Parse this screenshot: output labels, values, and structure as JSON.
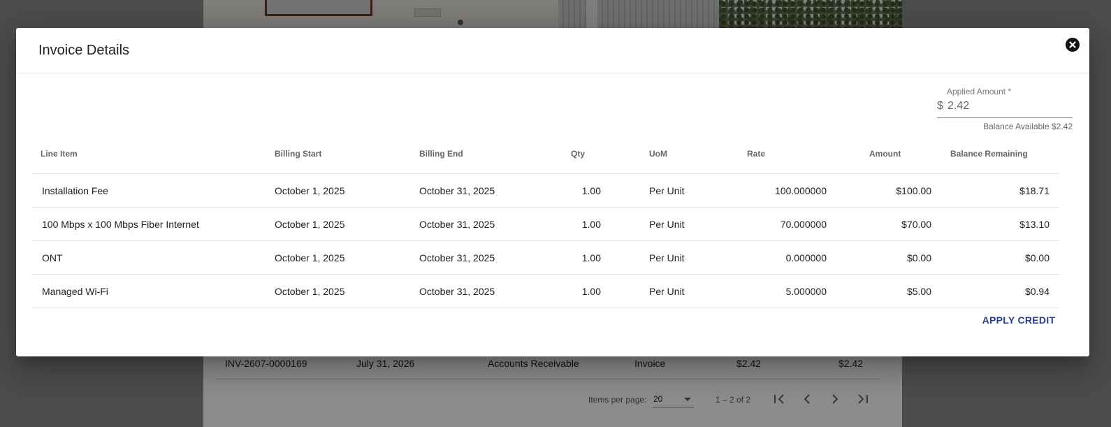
{
  "background": {
    "row": {
      "invoice": "INV-2607-0000169",
      "date": "July 31, 2026",
      "account": "Accounts Receivable",
      "type": "Invoice",
      "amount": "$2.42",
      "balance": "$2.42"
    },
    "paginator": {
      "items_per_page_label": "Items per page:",
      "items_per_page_value": "20",
      "range_label": "1 – 2 of 2"
    }
  },
  "dialog": {
    "title": "Invoice Details",
    "applied_amount": {
      "label": "Applied Amount *",
      "prefix": "$",
      "value": "2.42",
      "hint": "Balance Available $2.42"
    },
    "columns": [
      "Line Item",
      "Billing Start",
      "Billing End",
      "Qty",
      "UoM",
      "Rate",
      "Amount",
      "Balance Remaining"
    ],
    "rows": [
      {
        "item": "Installation Fee",
        "start": "October 1, 2025",
        "end": "October 31, 2025",
        "qty": "1.00",
        "uom": "Per Unit",
        "rate": "100.000000",
        "amount": "$100.00",
        "balance": "$18.71"
      },
      {
        "item": "100 Mbps x 100 Mbps Fiber Internet",
        "start": "October 1, 2025",
        "end": "October 31, 2025",
        "qty": "1.00",
        "uom": "Per Unit",
        "rate": "70.000000",
        "amount": "$70.00",
        "balance": "$13.10"
      },
      {
        "item": "ONT",
        "start": "October 1, 2025",
        "end": "October 31, 2025",
        "qty": "1.00",
        "uom": "Per Unit",
        "rate": "0.000000",
        "amount": "$0.00",
        "balance": "$0.00"
      },
      {
        "item": "Managed Wi-Fi",
        "start": "October 1, 2025",
        "end": "October 31, 2025",
        "qty": "1.00",
        "uom": "Per Unit",
        "rate": "5.000000",
        "amount": "$5.00",
        "balance": "$0.94"
      }
    ],
    "apply_button": "APPLY CREDIT"
  },
  "colors": {
    "accent": "#2a3a8c",
    "scrim": "rgba(0,0,0,0.45)"
  },
  "icons": {
    "close": "close-icon",
    "paginator_first": "first-page-icon",
    "paginator_prev": "chevron-left-icon",
    "paginator_next": "chevron-right-icon",
    "paginator_last": "last-page-icon",
    "select_caret": "caret-down-icon"
  }
}
